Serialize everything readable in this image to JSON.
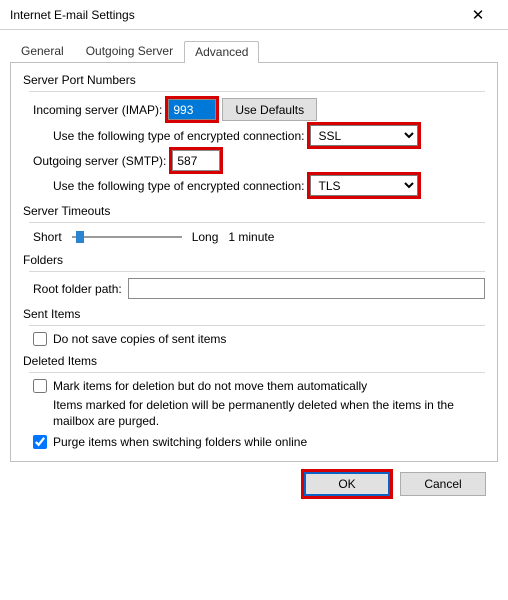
{
  "window": {
    "title": "Internet E-mail Settings"
  },
  "tabs": {
    "general": "General",
    "outgoing": "Outgoing Server",
    "advanced": "Advanced"
  },
  "server_ports": {
    "legend": "Server Port Numbers",
    "incoming_label": "Incoming server (IMAP):",
    "incoming_value": "993",
    "defaults_btn": "Use Defaults",
    "enc_label": "Use the following type of encrypted connection:",
    "incoming_enc": "SSL",
    "outgoing_label": "Outgoing server (SMTP):",
    "outgoing_value": "587",
    "outgoing_enc": "TLS"
  },
  "timeouts": {
    "legend": "Server Timeouts",
    "short": "Short",
    "long": "Long",
    "value": "1 minute"
  },
  "folders": {
    "legend": "Folders",
    "root_label": "Root folder path:",
    "root_value": ""
  },
  "sent": {
    "legend": "Sent Items",
    "dont_save_label": "Do not save copies of sent items",
    "dont_save_checked": false
  },
  "deleted": {
    "legend": "Deleted Items",
    "mark_label": "Mark items for deletion but do not move them automatically",
    "mark_checked": false,
    "note": "Items marked for deletion will be permanently deleted when the items in the mailbox are purged.",
    "purge_label": "Purge items when switching folders while online",
    "purge_checked": true
  },
  "buttons": {
    "ok": "OK",
    "cancel": "Cancel"
  }
}
